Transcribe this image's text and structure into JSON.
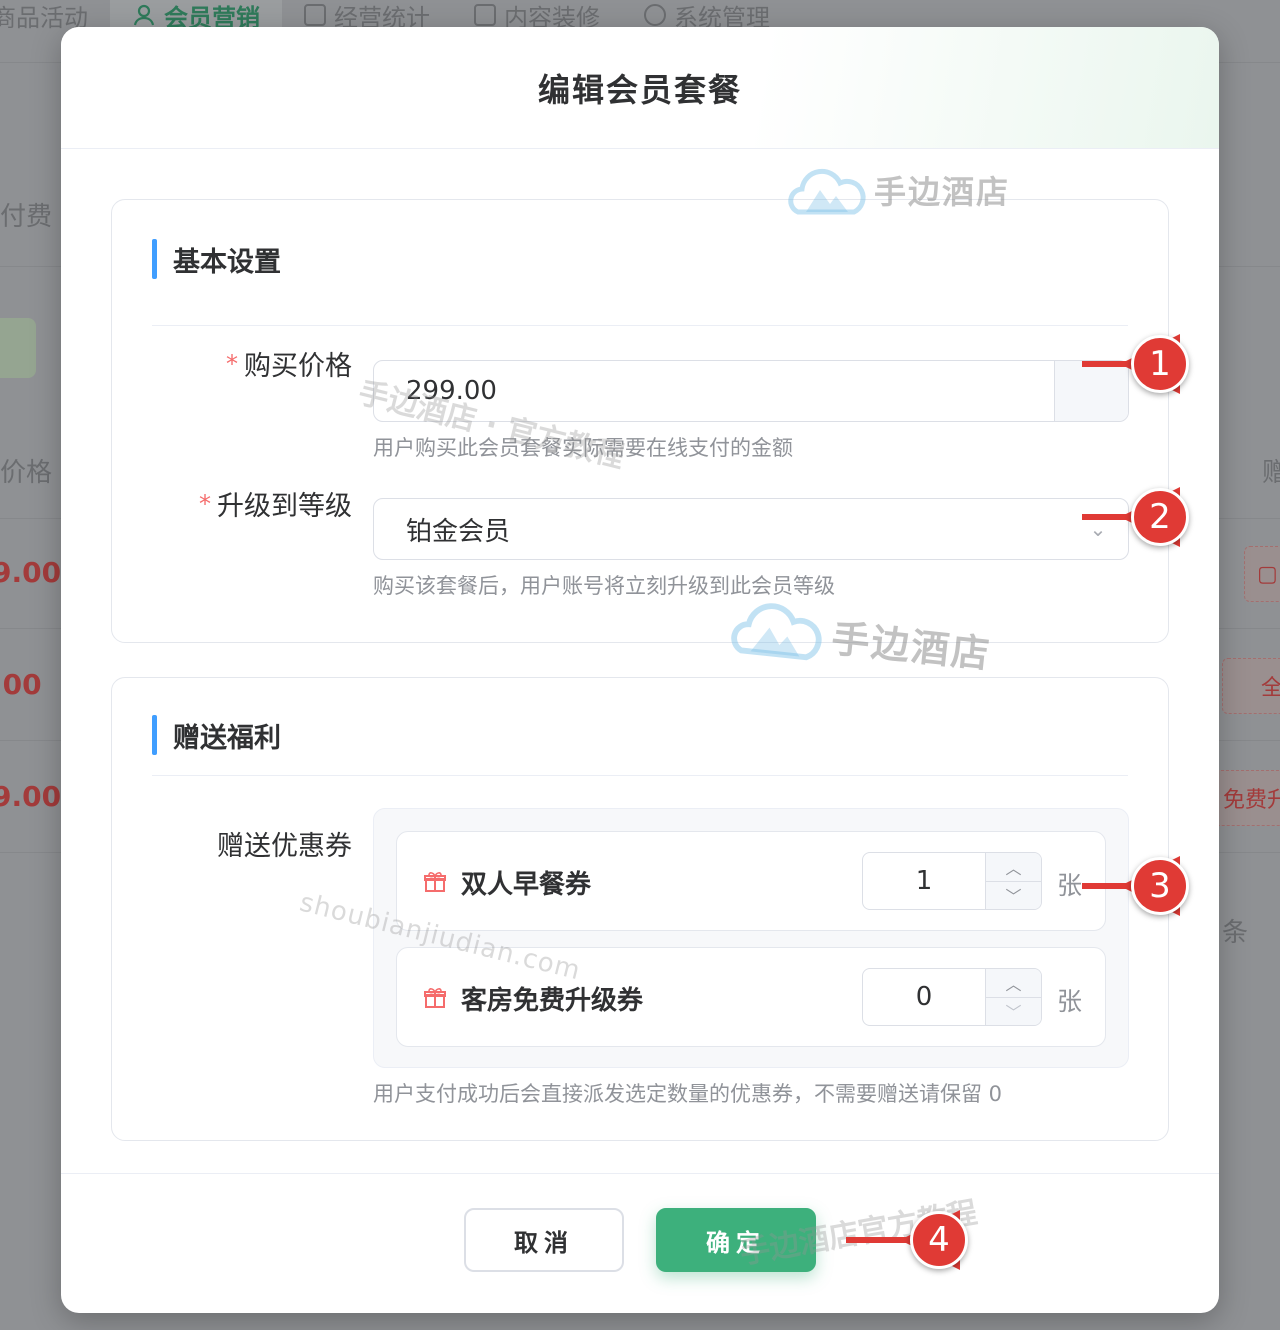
{
  "background": {
    "nav": [
      {
        "label": "商品活动",
        "active": false
      },
      {
        "label": "会员营销",
        "active": true
      },
      {
        "label": "经营统计",
        "active": false
      },
      {
        "label": "内容装修",
        "active": false
      },
      {
        "label": "系统管理",
        "active": false
      }
    ],
    "side_text_1": "付费",
    "col_price": "价格",
    "col_right": "赠",
    "prices": [
      "9.00",
      ".00",
      "9.00"
    ],
    "tags": [
      "全",
      "免费升"
    ],
    "pager_text": "条"
  },
  "dialog": {
    "title": "编辑会员套餐",
    "basic": {
      "section_title": "基本设置",
      "price_label": "购买价格",
      "price_value": "299.00",
      "price_hint": "用户购买此会员套餐实际需要在线支付的金额",
      "level_label": "升级到等级",
      "level_value": "铂金会员",
      "level_hint": "购买该套餐后，用户账号将立刻升级到此会员等级"
    },
    "gift": {
      "section_title": "赠送福利",
      "coupons_label": "赠送优惠券",
      "coupons": [
        {
          "name": "双人早餐券",
          "qty": "1",
          "unit": "张"
        },
        {
          "name": "客房免费升级券",
          "qty": "0",
          "unit": "张"
        }
      ],
      "hint": "用户支付成功后会直接派发选定数量的优惠券，不需要赠送请保留 0"
    },
    "footer": {
      "cancel": "取消",
      "confirm": "确定"
    }
  },
  "watermark": {
    "brand": "手边酒店",
    "tutorial": "手边酒店 · 官方教程",
    "url": "shoubianjiudian.com",
    "footer_mark": "手边酒店官方教程"
  },
  "annotations": [
    "1",
    "2",
    "3",
    "4"
  ],
  "colors": {
    "accent_green": "#3db07c",
    "required_red": "#f56c6c",
    "section_bar": "#409eff",
    "annotation_red": "#e03a35"
  }
}
